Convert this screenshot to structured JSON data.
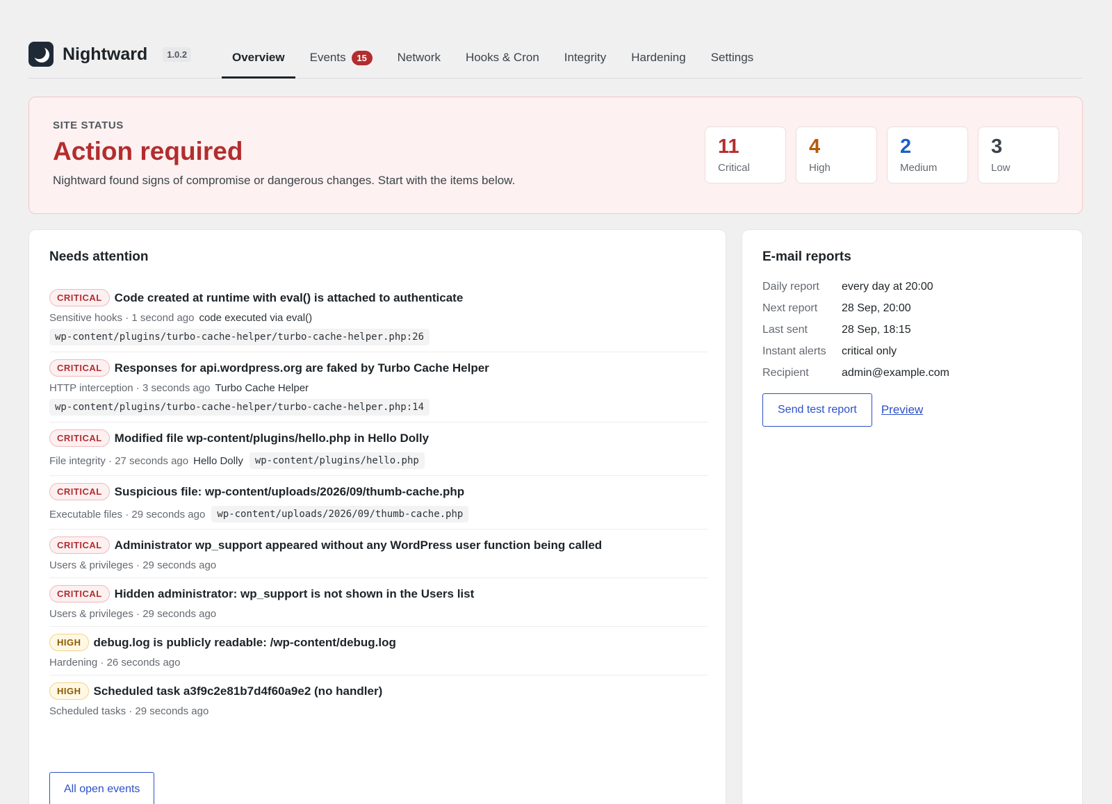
{
  "app": {
    "name": "Nightward",
    "version": "1.0.2"
  },
  "tabs": [
    {
      "label": "Overview",
      "active": true
    },
    {
      "label": "Events",
      "count": "15"
    },
    {
      "label": "Network"
    },
    {
      "label": "Hooks & Cron"
    },
    {
      "label": "Integrity"
    },
    {
      "label": "Hardening"
    },
    {
      "label": "Settings"
    }
  ],
  "status": {
    "label": "SITE STATUS",
    "title": "Action required",
    "description": "Nightward found signs of compromise or dangerous changes. Start with the items below.",
    "counters": [
      {
        "value": "11",
        "label": "Critical",
        "color": "#b32d2e"
      },
      {
        "value": "4",
        "label": "High",
        "color": "#b35c0a"
      },
      {
        "value": "2",
        "label": "Medium",
        "color": "#1f5fc8"
      },
      {
        "value": "3",
        "label": "Low",
        "color": "#3c434a"
      }
    ]
  },
  "attention": {
    "title": "Needs attention",
    "events": [
      {
        "severity": "CRITICAL",
        "title": "Code created at runtime with eval() is attached to authenticate",
        "category": "Sensitive hooks",
        "time": "1 second ago",
        "extra": "code executed via eval()",
        "code": "wp-content/plugins/turbo-cache-helper/turbo-cache-helper.php:26"
      },
      {
        "severity": "CRITICAL",
        "title": "Responses for api.wordpress.org are faked by Turbo Cache Helper",
        "category": "HTTP interception",
        "time": "3 seconds ago",
        "extra": "Turbo Cache Helper",
        "code": "wp-content/plugins/turbo-cache-helper/turbo-cache-helper.php:14"
      },
      {
        "severity": "CRITICAL",
        "title": "Modified file wp-content/plugins/hello.php in Hello Dolly",
        "category": "File integrity",
        "time": "27 seconds ago",
        "extra": "Hello Dolly",
        "inline_code": "wp-content/plugins/hello.php"
      },
      {
        "severity": "CRITICAL",
        "title": "Suspicious file: wp-content/uploads/2026/09/thumb-cache.php",
        "category": "Executable files",
        "time": "29 seconds ago",
        "inline_code": "wp-content/uploads/2026/09/thumb-cache.php"
      },
      {
        "severity": "CRITICAL",
        "title": "Administrator wp_support appeared without any WordPress user function being called",
        "category": "Users & privileges",
        "time": "29 seconds ago"
      },
      {
        "severity": "CRITICAL",
        "title": "Hidden administrator: wp_support is not shown in the Users list",
        "category": "Users & privileges",
        "time": "29 seconds ago"
      },
      {
        "severity": "HIGH",
        "title": "debug.log is publicly readable: /wp-content/debug.log",
        "category": "Hardening",
        "time": "26 seconds ago"
      },
      {
        "severity": "HIGH",
        "title": "Scheduled task a3f9c2e81b7d4f60a9e2 (no handler)",
        "category": "Scheduled tasks",
        "time": "29 seconds ago"
      }
    ],
    "all_events_label": "All open events"
  },
  "email": {
    "title": "E-mail reports",
    "rows": [
      {
        "key": "Daily report",
        "value": "every day at 20:00"
      },
      {
        "key": "Next report",
        "value": "28 Sep, 20:00"
      },
      {
        "key": "Last sent",
        "value": "28 Sep, 18:15"
      },
      {
        "key": "Instant alerts",
        "value": "critical only"
      },
      {
        "key": "Recipient",
        "value": "admin@example.com"
      }
    ],
    "send_label": "Send test report",
    "preview_label": "Preview"
  }
}
